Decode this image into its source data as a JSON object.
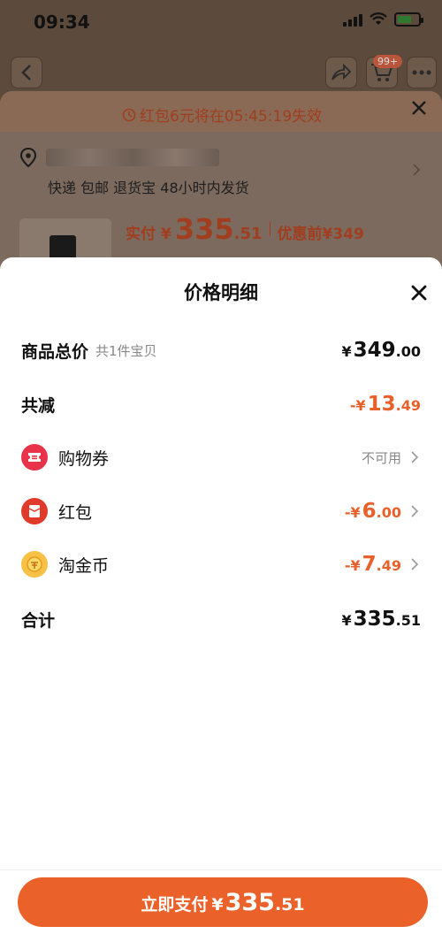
{
  "status_bar": {
    "time": "09:34"
  },
  "top_nav": {
    "cart_badge": "99+"
  },
  "background_sheet": {
    "notice": "红包6元将在05:45:19失效",
    "delivery_meta": "快递 包邮 退货宝 48小时内发货",
    "pay_label": "实付",
    "pay_currency": "¥",
    "pay_int": "335",
    "pay_dec": ".51",
    "pre_discount": "优惠前¥349"
  },
  "price_detail": {
    "title": "价格明细",
    "items_total": {
      "label": "商品总价",
      "sub": "共1件宝贝",
      "currency": "¥",
      "int": "349",
      "dec": ".00"
    },
    "total_reduction": {
      "label": "共减",
      "currency": "-¥",
      "int": "13",
      "dec": ".49"
    },
    "coupon": {
      "label": "购物券",
      "status": "不可用",
      "icon": "coupon-icon"
    },
    "red_packet": {
      "label": "红包",
      "currency": "-¥",
      "int": "6",
      "dec": ".00",
      "icon": "red-packet-icon"
    },
    "taojinbi": {
      "label": "淘金币",
      "currency": "-¥",
      "int": "7",
      "dec": ".49",
      "icon": "taojinbi-coin-icon"
    },
    "grand_total": {
      "label": "合计",
      "currency": "¥",
      "int": "335",
      "dec": ".51"
    }
  },
  "pay_button": {
    "label": "立即支付",
    "currency": "¥",
    "int": "335",
    "dec": ".51"
  },
  "colors": {
    "accent": "#ea6129",
    "discount": "#e8602a",
    "muted": "#888888"
  }
}
